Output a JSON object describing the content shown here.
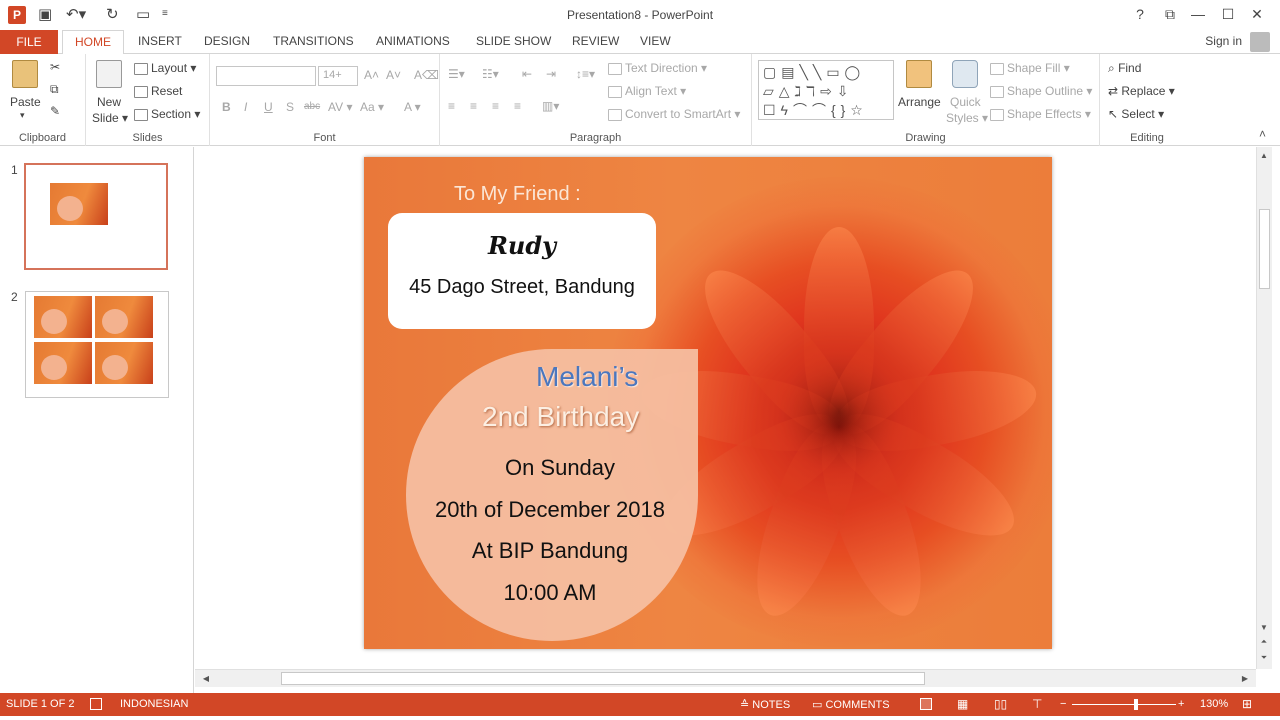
{
  "titlebar": {
    "title": "Presentation8 - PowerPoint",
    "app_icon": "P",
    "qat_icons": [
      "save-icon",
      "undo-icon",
      "redo-icon",
      "present-from-start-icon",
      "customize-qat-icon"
    ],
    "help": "?",
    "ribbon_display": "⧉",
    "minimize": "—",
    "maximize": "☐",
    "close": "✕"
  },
  "tabs": {
    "file": "FILE",
    "home": "HOME",
    "insert": "INSERT",
    "design": "DESIGN",
    "transitions": "TRANSITIONS",
    "animations": "ANIMATIONS",
    "slideshow": "SLIDE SHOW",
    "review": "REVIEW",
    "view": "VIEW",
    "signin": "Sign in"
  },
  "ribbon": {
    "clipboard": {
      "label": "Clipboard",
      "paste": "Paste",
      "paste_arrow": "▾"
    },
    "slides": {
      "label": "Slides",
      "new_slide_1": "New",
      "new_slide_2": "Slide ▾",
      "layout": "Layout ▾",
      "reset": "Reset",
      "section": "Section ▾"
    },
    "font": {
      "label": "Font",
      "font_name": "",
      "font_size": "14+",
      "grow": "A˄",
      "shrink": "A˅",
      "clear": "A⌫",
      "bold": "B",
      "italic": "I",
      "underline": "U",
      "shadow": "S",
      "strike": "abc",
      "spacing": "AV ▾",
      "case": "Aa ▾",
      "color": "A ▾"
    },
    "paragraph": {
      "label": "Paragraph",
      "text_direction": "Text Direction ▾",
      "align_text": "Align Text ▾",
      "smartart": "Convert to SmartArt ▾"
    },
    "drawing": {
      "label": "Drawing",
      "arrange": "Arrange",
      "quick_styles_1": "Quick",
      "quick_styles_2": "Styles ▾",
      "shape_fill": "Shape Fill ▾",
      "shape_outline": "Shape Outline ▾",
      "shape_effects": "Shape Effects ▾",
      "shapes_row1": "▢▤╲╲▭◯",
      "shapes_row2": "▱△ℷℸ⇨⇩",
      "shapes_row3": "☐ϟ⌒⌒{}☆"
    },
    "editing": {
      "label": "Editing",
      "find": "Find",
      "replace": "Replace ▾",
      "select": "Select ▾"
    },
    "collapse": "˄"
  },
  "thumbnails": [
    {
      "number": "1",
      "selected": true
    },
    {
      "number": "2",
      "selected": false
    }
  ],
  "slide": {
    "friend_label": "To My Friend :",
    "recipient": "Rudy",
    "address": "45 Dago Street, Bandung",
    "name_line": "Melani’s",
    "birthday_line": "2nd Birthday",
    "day": "On Sunday",
    "date": "20th of December 2018",
    "venue": "At BIP Bandung",
    "time": "10:00 AM"
  },
  "statusbar": {
    "slide_count": "SLIDE 1 OF 2",
    "language": "INDONESIAN",
    "notes": "NOTES",
    "comments": "COMMENTS",
    "zoom_minus": "−",
    "zoom_plus": "+",
    "zoom": "130%",
    "zoom_level_fraction": 0.62
  },
  "colors": {
    "accent": "#d24726",
    "slide_bg": "#ec7d3a",
    "name_color": "#4b77be"
  }
}
